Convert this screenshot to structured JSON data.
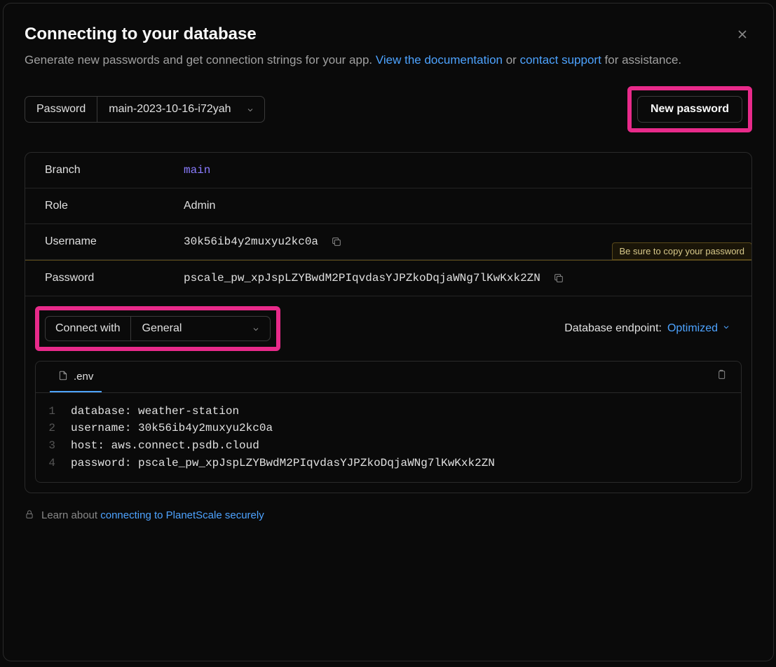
{
  "header": {
    "title": "Connecting to your database",
    "subtitle_pre": "Generate new passwords and get connection strings for your app. ",
    "doc_link_text": "View the documentation",
    "subtitle_mid": " or ",
    "support_link_text": "contact support",
    "subtitle_post": " for assistance."
  },
  "toolbar": {
    "password_label": "Password",
    "password_dropdown_value": "main-2023-10-16-i72yah",
    "new_password_button": "New password"
  },
  "details": {
    "branch_label": "Branch",
    "branch_value": "main",
    "role_label": "Role",
    "role_value": "Admin",
    "username_label": "Username",
    "username_value": "30k56ib4y2muxyu2kc0a",
    "password_label": "Password",
    "password_value": "pscale_pw_xpJspLZYBwdM2PIqvdasYJPZkoDqjaWNg7lKwKxk2ZN",
    "password_tip": "Be sure to copy your password"
  },
  "connect": {
    "label": "Connect with",
    "dropdown_value": "General",
    "endpoint_label": "Database endpoint:",
    "endpoint_value": "Optimized"
  },
  "code": {
    "tab_filename": ".env",
    "lines": [
      "database: weather-station",
      "username: 30k56ib4y2muxyu2kc0a",
      "host: aws.connect.psdb.cloud",
      "password: pscale_pw_xpJspLZYBwdM2PIqvdasYJPZkoDqjaWNg7lKwKxk2ZN"
    ]
  },
  "footer": {
    "text": "Learn about ",
    "link_text": "connecting to PlanetScale securely"
  }
}
